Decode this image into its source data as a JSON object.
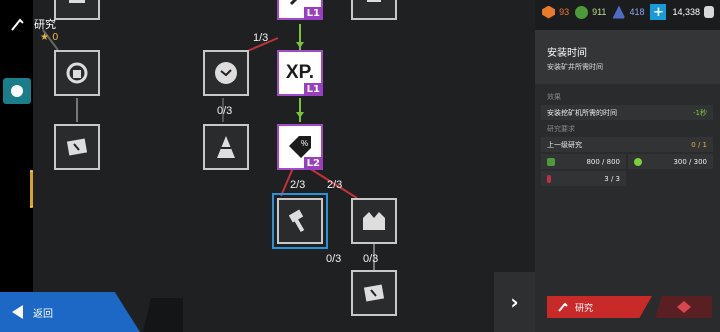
{
  "header": {
    "title": "研究",
    "stars": "0"
  },
  "resources": [
    {
      "value": "93",
      "color": "#e87a2c",
      "icon": "hexagon-resource-icon"
    },
    {
      "value": "911",
      "color": "#7ccf3c",
      "icon": "gem-resource-icon"
    },
    {
      "value": "418",
      "color": "#5a7ad6",
      "icon": "ore-resource-icon"
    },
    {
      "value": "14,338",
      "color": "#ffffff",
      "icon": "cash-icon"
    }
  ],
  "tree": {
    "nodes": [
      {
        "label": "XP.",
        "level": "L1"
      },
      {
        "label": "SELL",
        "level": "L2"
      }
    ],
    "top_level": "L1",
    "counts": [
      "1/3",
      "0/3",
      "2/3",
      "2/3",
      "0/3",
      "0/3"
    ]
  },
  "buttons": {
    "back": "返回",
    "next": "›"
  },
  "panel": {
    "title": "安装时间",
    "subtitle": "安装矿井所需时间",
    "effect_label": "效果",
    "effect_text": "安装挖矿机所需的时间",
    "effect_value": "-1秒",
    "req_label": "研究要求",
    "prev_label": "上一级研究",
    "prev_value": "0 / 1",
    "res1_value": "800 / 800",
    "res2_value": "300 / 300",
    "res3_value": "3 / 3",
    "research_button": "研究"
  },
  "colors": {
    "accent_blue": "#1c68c4",
    "research_red": "#c82a2a",
    "level_purple": "#9a3fc0",
    "link_red": "#c0333a",
    "link_green": "#7bc23a"
  }
}
